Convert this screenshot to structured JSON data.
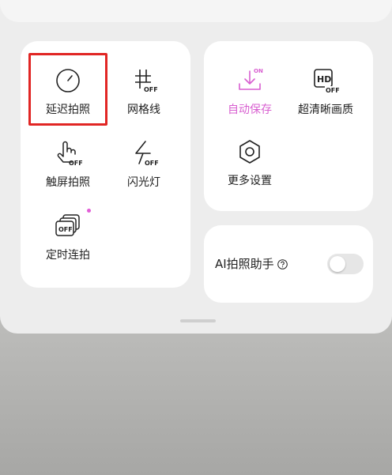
{
  "colors": {
    "accent_pink": "#d85fd0",
    "highlight_red": "#e12624",
    "text": "#222222"
  },
  "left_panel": {
    "items": [
      {
        "label": "延迟拍照",
        "icon": "timer-icon"
      },
      {
        "label": "网格线",
        "icon": "grid-icon",
        "badge": "OFF"
      },
      {
        "label": "触屏拍照",
        "icon": "touch-capture-icon",
        "badge": "OFF"
      },
      {
        "label": "闪光灯",
        "icon": "flash-icon",
        "badge": "OFF"
      },
      {
        "label": "定时连拍",
        "icon": "burst-icon",
        "badge": "OFF"
      }
    ]
  },
  "right_panel": {
    "items": [
      {
        "label": "自动保存",
        "icon": "download-icon",
        "badge": "ON"
      },
      {
        "label": "超清晰画质",
        "icon": "hd-icon",
        "badge": "OFF",
        "icon_text": "HD"
      },
      {
        "label": "更多设置",
        "icon": "settings-hexagon-icon"
      }
    ]
  },
  "ai_assistant": {
    "label": "AI拍照助手",
    "enabled": false
  }
}
